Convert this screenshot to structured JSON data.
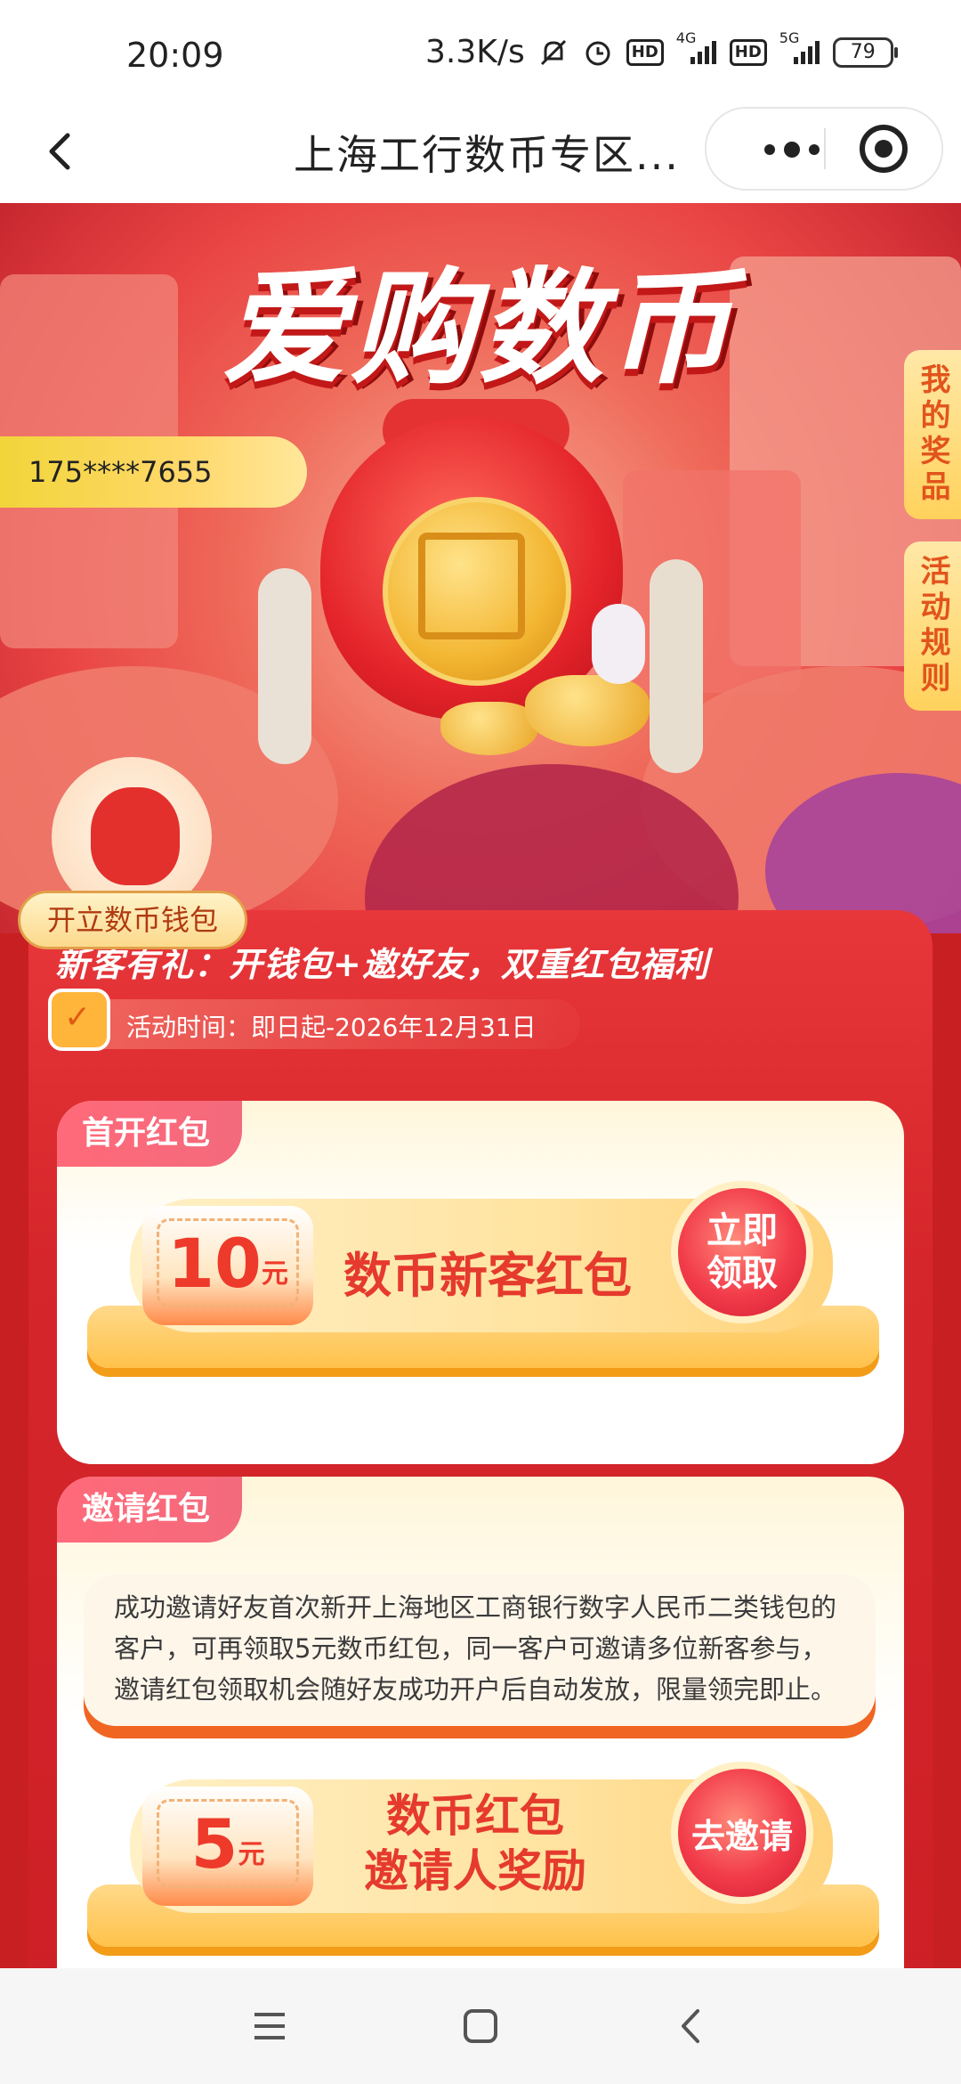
{
  "status_bar": {
    "time": "20:09",
    "net_speed": "3.3K/s",
    "signal1_label": "4G",
    "signal2_label": "5G",
    "hd1": "HD",
    "hd2": "HD",
    "battery": "79"
  },
  "nav": {
    "title": "上海工行数币专区..."
  },
  "hero": {
    "title": "爱购数币",
    "phone": "175****7655",
    "side_tab_prizes": "我的奖品",
    "side_tab_rules": "活动规则",
    "wallet_label": "开立数币钱包"
  },
  "panel": {
    "headline": "新客有礼：开钱包+邀好友，双重红包福利",
    "activity_time": "活动时间：即日起-2026年12月31日"
  },
  "card_first": {
    "tag": "首开红包",
    "amount": "10",
    "unit": "元",
    "title": "数币新客红包",
    "button_line1": "立即",
    "button_line2": "领取"
  },
  "card_invite": {
    "tag": "邀请红包",
    "description": "成功邀请好友首次新开上海地区工商银行数字人民币二类钱包的客户，可再领取5元数币红包，同一客户可邀请多位新客参与，邀请红包领取机会随好友成功开户后自动发放，限量领完即止。",
    "amount": "5",
    "unit": "元",
    "title_line1": "数币红包",
    "title_line2": "邀请人奖励",
    "button": "去邀请"
  },
  "colors": {
    "primary_red": "#d5262b",
    "accent_gold": "#ffc24a",
    "tag_pink": "#f36a7c"
  }
}
